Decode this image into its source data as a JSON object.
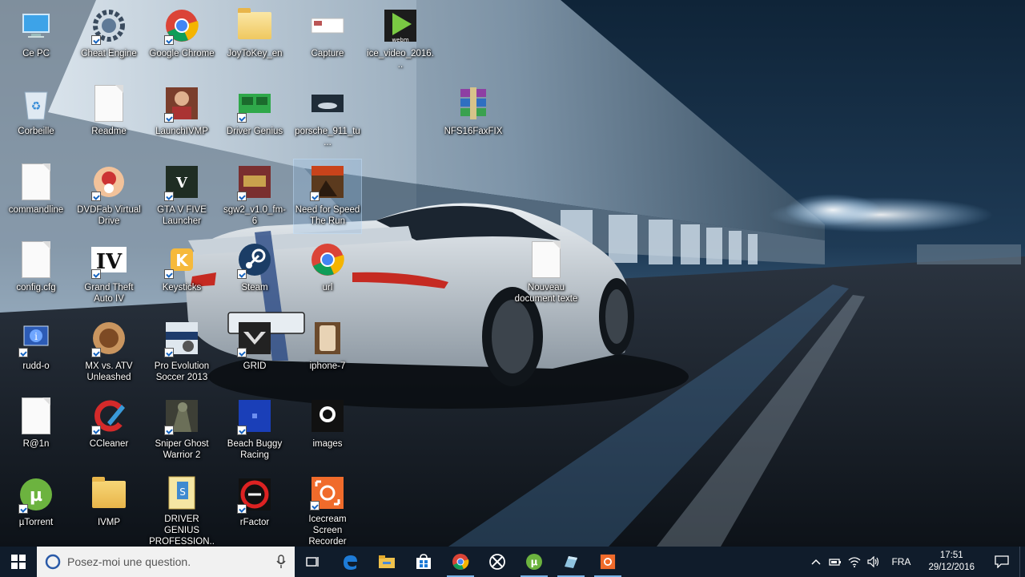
{
  "desktop": {
    "icons": [
      {
        "label": "Ce PC",
        "icon": "computer-icon"
      },
      {
        "label": "Cheat Engine",
        "icon": "cheat-engine-icon"
      },
      {
        "label": "Google Chrome",
        "icon": "chrome-icon"
      },
      {
        "label": "JoyToKey_en",
        "icon": "folder-icon"
      },
      {
        "label": "Capture",
        "icon": "image-thumbnail-icon"
      },
      {
        "label": "ice_video_2016...",
        "icon": "webm-video-icon"
      },
      {
        "label": "Corbeille",
        "icon": "recycle-bin-icon"
      },
      {
        "label": "Readme",
        "icon": "text-file-icon"
      },
      {
        "label": "LaunchIVMP",
        "icon": "ivmp-launcher-icon"
      },
      {
        "label": "Driver Genius",
        "icon": "driver-genius-icon"
      },
      {
        "label": "porsche_911_tu...",
        "icon": "image-thumbnail-icon"
      },
      {
        "label": "NFS16FaxFIX",
        "icon": "winrar-archive-icon"
      },
      {
        "label": "commandline",
        "icon": "text-file-icon"
      },
      {
        "label": "DVDFab Virtual Drive",
        "icon": "dvdfab-icon"
      },
      {
        "label": "GTA V FIVE Launcher",
        "icon": "gta-v-icon"
      },
      {
        "label": "sgw2_v1.0_fm-6",
        "icon": "game-app-icon"
      },
      {
        "label": "Need for Speed The Run",
        "icon": "nfs-the-run-icon"
      },
      {
        "label": "config.cfg",
        "icon": "text-file-icon"
      },
      {
        "label": "Grand Theft Auto IV",
        "icon": "gta-iv-icon"
      },
      {
        "label": "Keysticks",
        "icon": "keysticks-icon"
      },
      {
        "label": "Steam",
        "icon": "steam-icon"
      },
      {
        "label": "url",
        "icon": "chrome-icon"
      },
      {
        "label": "Nouveau document texte",
        "icon": "text-file-icon"
      },
      {
        "label": "rudd-o",
        "icon": "info-app-icon"
      },
      {
        "label": "MX vs. ATV Unleashed",
        "icon": "mx-atv-icon"
      },
      {
        "label": "Pro Evolution Soccer 2013",
        "icon": "pes-2013-icon"
      },
      {
        "label": "GRID",
        "icon": "grid-game-icon"
      },
      {
        "label": "iphone-7",
        "icon": "image-thumbnail-icon"
      },
      {
        "label": "R@1n",
        "icon": "text-file-icon"
      },
      {
        "label": "CCleaner",
        "icon": "ccleaner-icon"
      },
      {
        "label": "Sniper Ghost Warrior 2",
        "icon": "sniper-ghost-warrior-icon"
      },
      {
        "label": "Beach Buggy Racing",
        "icon": "beach-buggy-racing-icon"
      },
      {
        "label": "images",
        "icon": "image-thumbnail-icon"
      },
      {
        "label": "µTorrent",
        "icon": "utorrent-icon"
      },
      {
        "label": "IVMP",
        "icon": "folder-icon"
      },
      {
        "label": "DRIVER GENIUS PROFESSION...",
        "icon": "archive-file-icon"
      },
      {
        "label": "rFactor",
        "icon": "rfactor-icon"
      },
      {
        "label": "Icecream Screen Recorder",
        "icon": "icecream-recorder-icon"
      }
    ]
  },
  "taskbar": {
    "search_placeholder": "Posez-moi une question.",
    "pinned": [
      {
        "name": "task-view",
        "icon": "task-view-icon"
      },
      {
        "name": "edge",
        "icon": "edge-icon"
      },
      {
        "name": "file-explorer",
        "icon": "file-explorer-icon"
      },
      {
        "name": "store",
        "icon": "store-icon"
      },
      {
        "name": "chrome",
        "icon": "chrome-icon"
      },
      {
        "name": "xbox",
        "icon": "xbox-icon"
      },
      {
        "name": "utorrent",
        "icon": "utorrent-icon"
      },
      {
        "name": "app",
        "icon": "app-icon"
      },
      {
        "name": "icecream-recorder",
        "icon": "icecream-recorder-icon"
      }
    ],
    "language": "FRA",
    "time": "17:51",
    "date": "29/12/2016"
  },
  "colors": {
    "taskbar_bg": "#101c2b",
    "accent": "#7ab3e6",
    "icon_label": "#ffffff"
  }
}
